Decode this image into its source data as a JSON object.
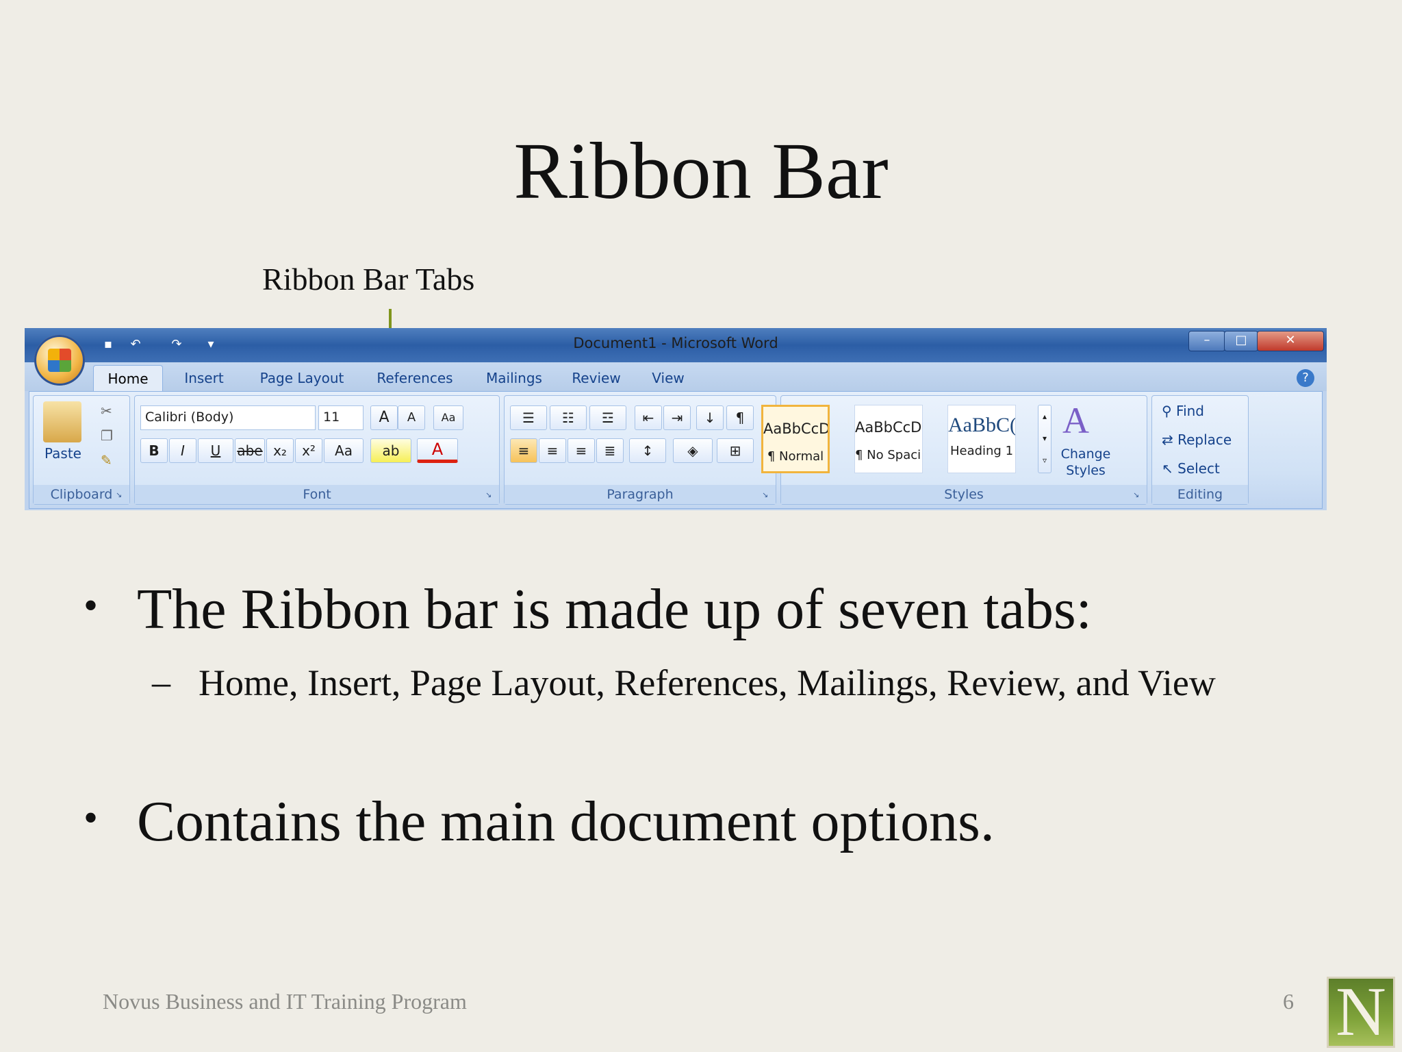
{
  "slide": {
    "title": "Ribbon Bar",
    "callout": "Ribbon Bar Tabs",
    "bullets": [
      {
        "text": "The Ribbon bar is made up of  seven tabs:",
        "sub": "Home, Insert, Page Layout, References, Mailings, Review, and View"
      },
      {
        "text": "Contains the main document options."
      }
    ],
    "footer": "Novus Business and IT Training Program",
    "page_number": "6",
    "logo_letter": "N"
  },
  "ribbon": {
    "window_title": "Document1 - Microsoft Word",
    "qat": [
      "save-icon",
      "undo-icon",
      "redo-icon",
      "customize-icon"
    ],
    "tabs": [
      "Home",
      "Insert",
      "Page Layout",
      "References",
      "Mailings",
      "Review",
      "View"
    ],
    "active_tab": "Home",
    "groups": {
      "clipboard": {
        "label": "Clipboard",
        "paste": "Paste"
      },
      "font": {
        "label": "Font",
        "font_name": "Calibri (Body)",
        "font_size": "11",
        "buttons": [
          "B",
          "I",
          "U",
          "abe",
          "x₂",
          "x²",
          "Aa"
        ]
      },
      "paragraph": {
        "label": "Paragraph"
      },
      "styles": {
        "label": "Styles",
        "items": [
          {
            "sample": "AaBbCcDc",
            "name": "¶ Normal"
          },
          {
            "sample": "AaBbCcDc",
            "name": "¶ No Spaci..."
          },
          {
            "sample": "AaBbC(",
            "name": "Heading 1"
          }
        ],
        "change_styles": "Change Styles"
      },
      "editing": {
        "label": "Editing",
        "find": "Find",
        "replace": "Replace",
        "select": "Select"
      }
    },
    "colors": {
      "accent": "#7f951c",
      "titlebar": "#2c5ea6",
      "ribbon": "#bfd3ee"
    }
  }
}
